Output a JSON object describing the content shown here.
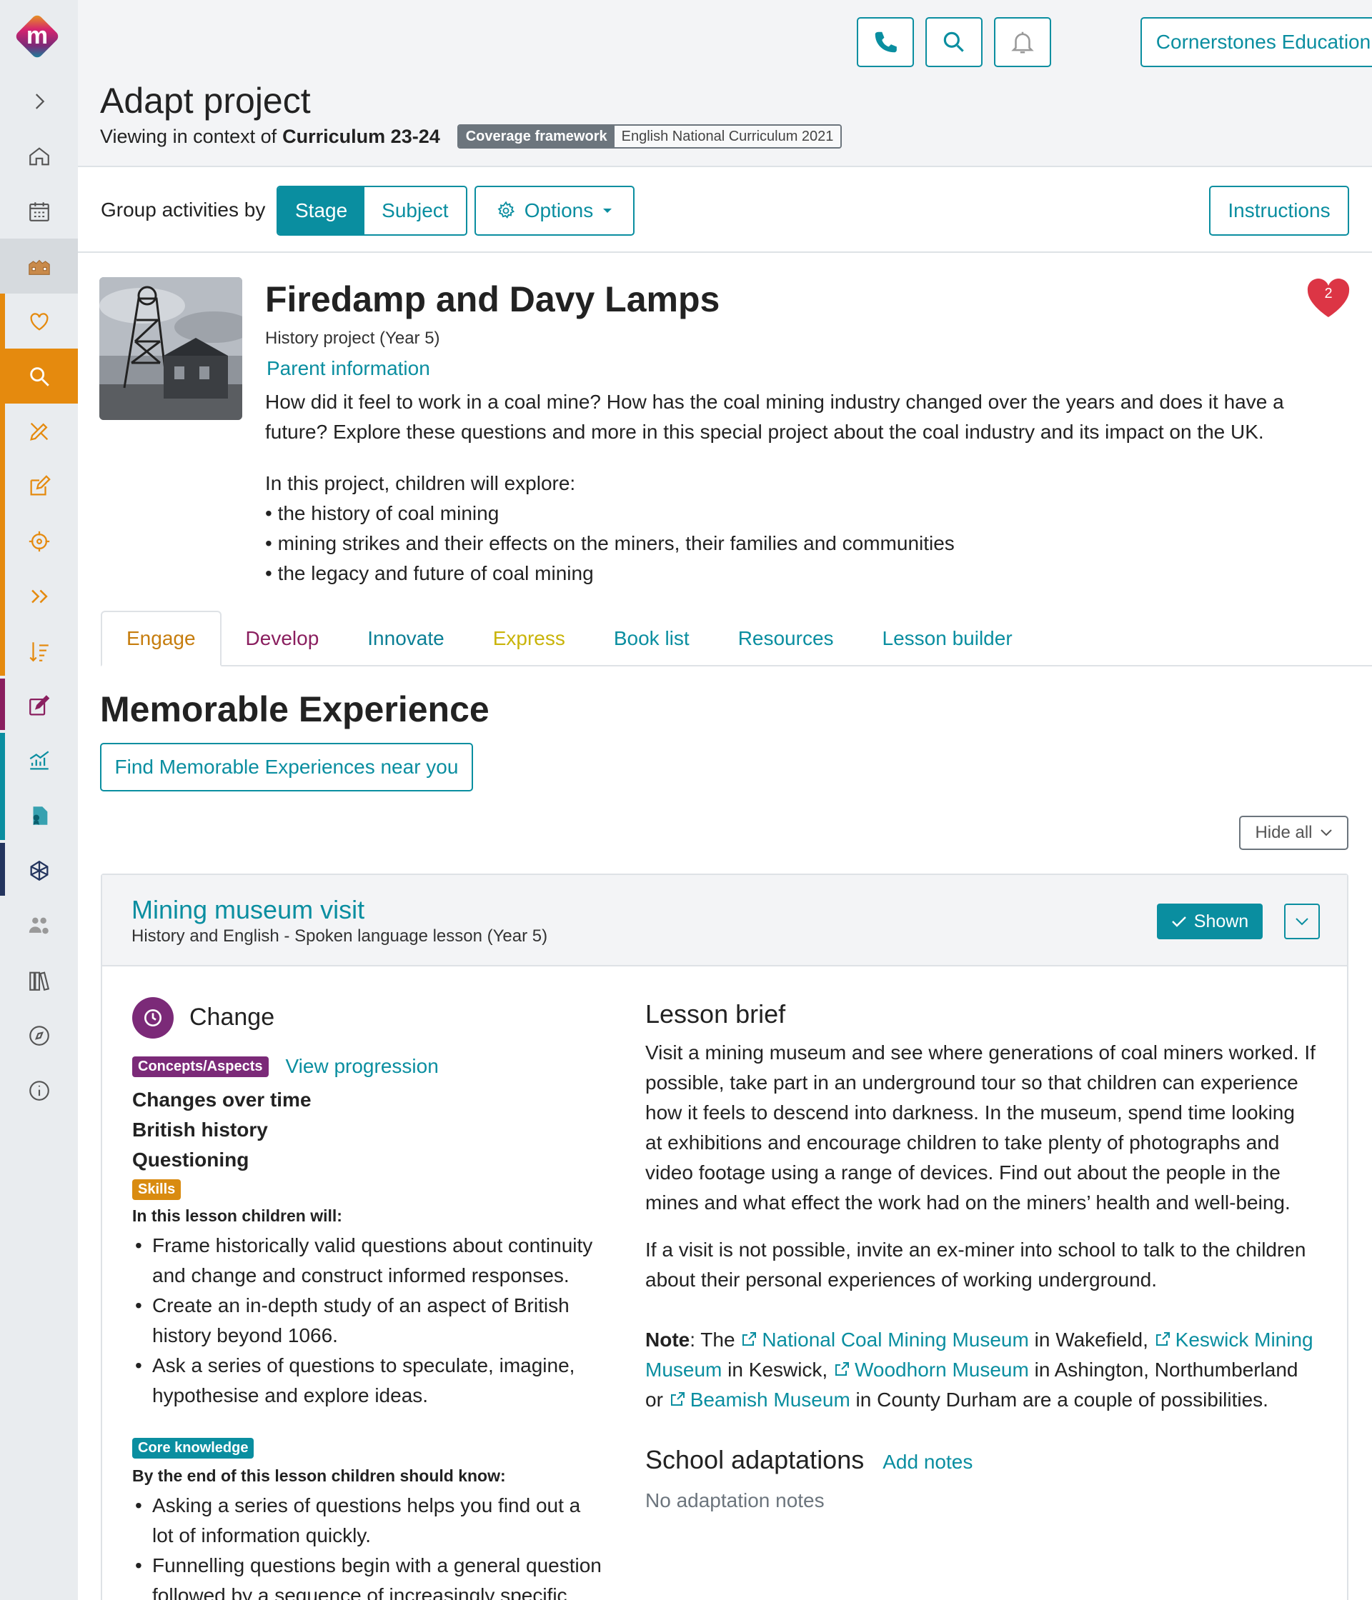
{
  "header": {
    "org_name": "Cornerstones Education",
    "page_title": "Adapt project",
    "context_prefix": "Viewing in context of",
    "context_value": "Curriculum 23-24",
    "framework_label": "Coverage framework",
    "framework_value": "English National Curriculum 2021"
  },
  "toolbar": {
    "group_label": "Group activities by",
    "group_options": [
      "Stage",
      "Subject"
    ],
    "selected_group": "Stage",
    "options_label": "Options",
    "instructions_label": "Instructions"
  },
  "project": {
    "title": "Firedamp and Davy Lamps",
    "subtitle": "History project (Year 5)",
    "parent_link": "Parent information",
    "description": "How did it feel to work in a coal mine? How has the coal mining industry changed over the years and does it have a future? Explore these questions and more in this special project about the coal industry and its impact on the UK.",
    "explore_intro": "In this project, children will explore:",
    "explore_items": [
      "• the history of coal mining",
      "• mining strikes and their effects on the miners, their families and communities",
      "• the legacy and future of coal mining"
    ],
    "favourite_count": "2"
  },
  "tabs": [
    {
      "label": "Engage",
      "color": "#c67d0e"
    },
    {
      "label": "Develop",
      "color": "#8a1f5f"
    },
    {
      "label": "Innovate",
      "color": "#0a7f95"
    },
    {
      "label": "Express",
      "color": "#c9b40a"
    },
    {
      "label": "Book list",
      "color": "#0a8ea0"
    },
    {
      "label": "Resources",
      "color": "#0a8ea0"
    },
    {
      "label": "Lesson builder",
      "color": "#0a8ea0"
    }
  ],
  "section": {
    "title": "Memorable Experience",
    "find_button": "Find Memorable Experiences near you",
    "hide_all": "Hide all"
  },
  "lesson": {
    "title": "Mining museum visit",
    "subtitle": "History and English - Spoken language lesson (Year 5)",
    "shown_label": "Shown",
    "concept": "Change",
    "concepts_badge": "Concepts/Aspects",
    "view_progression": "View progression",
    "concepts": [
      "Changes over time",
      "British history",
      "Questioning"
    ],
    "skills_badge": "Skills",
    "skills_intro": "In this lesson children will:",
    "skills": [
      "Frame historically valid questions about continuity and change and construct informed responses.",
      "Create an in-depth study of an aspect of British history beyond 1066.",
      "Ask a series of questions to speculate, imagine, hypothesise and explore ideas."
    ],
    "core_badge": "Core knowledge",
    "core_intro": "By the end of this lesson children should know:",
    "core": [
      "Asking a series of questions helps you find out a lot of information quickly.",
      "Funnelling questions begin with a general question followed by a sequence of increasingly specific"
    ],
    "brief_heading": "Lesson brief",
    "brief_p1": "Visit a mining museum and see where generations of coal miners worked. If possible, take part in an underground tour so that children can experience how it feels to descend into darkness. In the museum, spend time looking at exhibitions and encourage children to take plenty of photographs and video footage using a range of devices. Find out about the people in the mines and what effect the work had on the miners’ health and well-being.",
    "brief_p2": "If a visit is not possible, invite an ex-miner into school to talk to the children about their personal experiences of working underground.",
    "note_label": "Note",
    "note_the": ": The",
    "museum_1": "National Coal Mining Museum",
    "museum_1_loc": " in Wakefield, ",
    "museum_2": "Keswick Mining Museum",
    "museum_2_loc": " in Keswick, ",
    "museum_3": "Woodhorn Museum",
    "museum_3_loc": " in Ashington, Northumberland or ",
    "museum_4": "Beamish Museum",
    "museum_4_loc": " in County Durham are a couple of possibilities.",
    "adapt_heading": "School adaptations",
    "add_notes": "Add notes",
    "no_notes": "No adaptation notes"
  }
}
